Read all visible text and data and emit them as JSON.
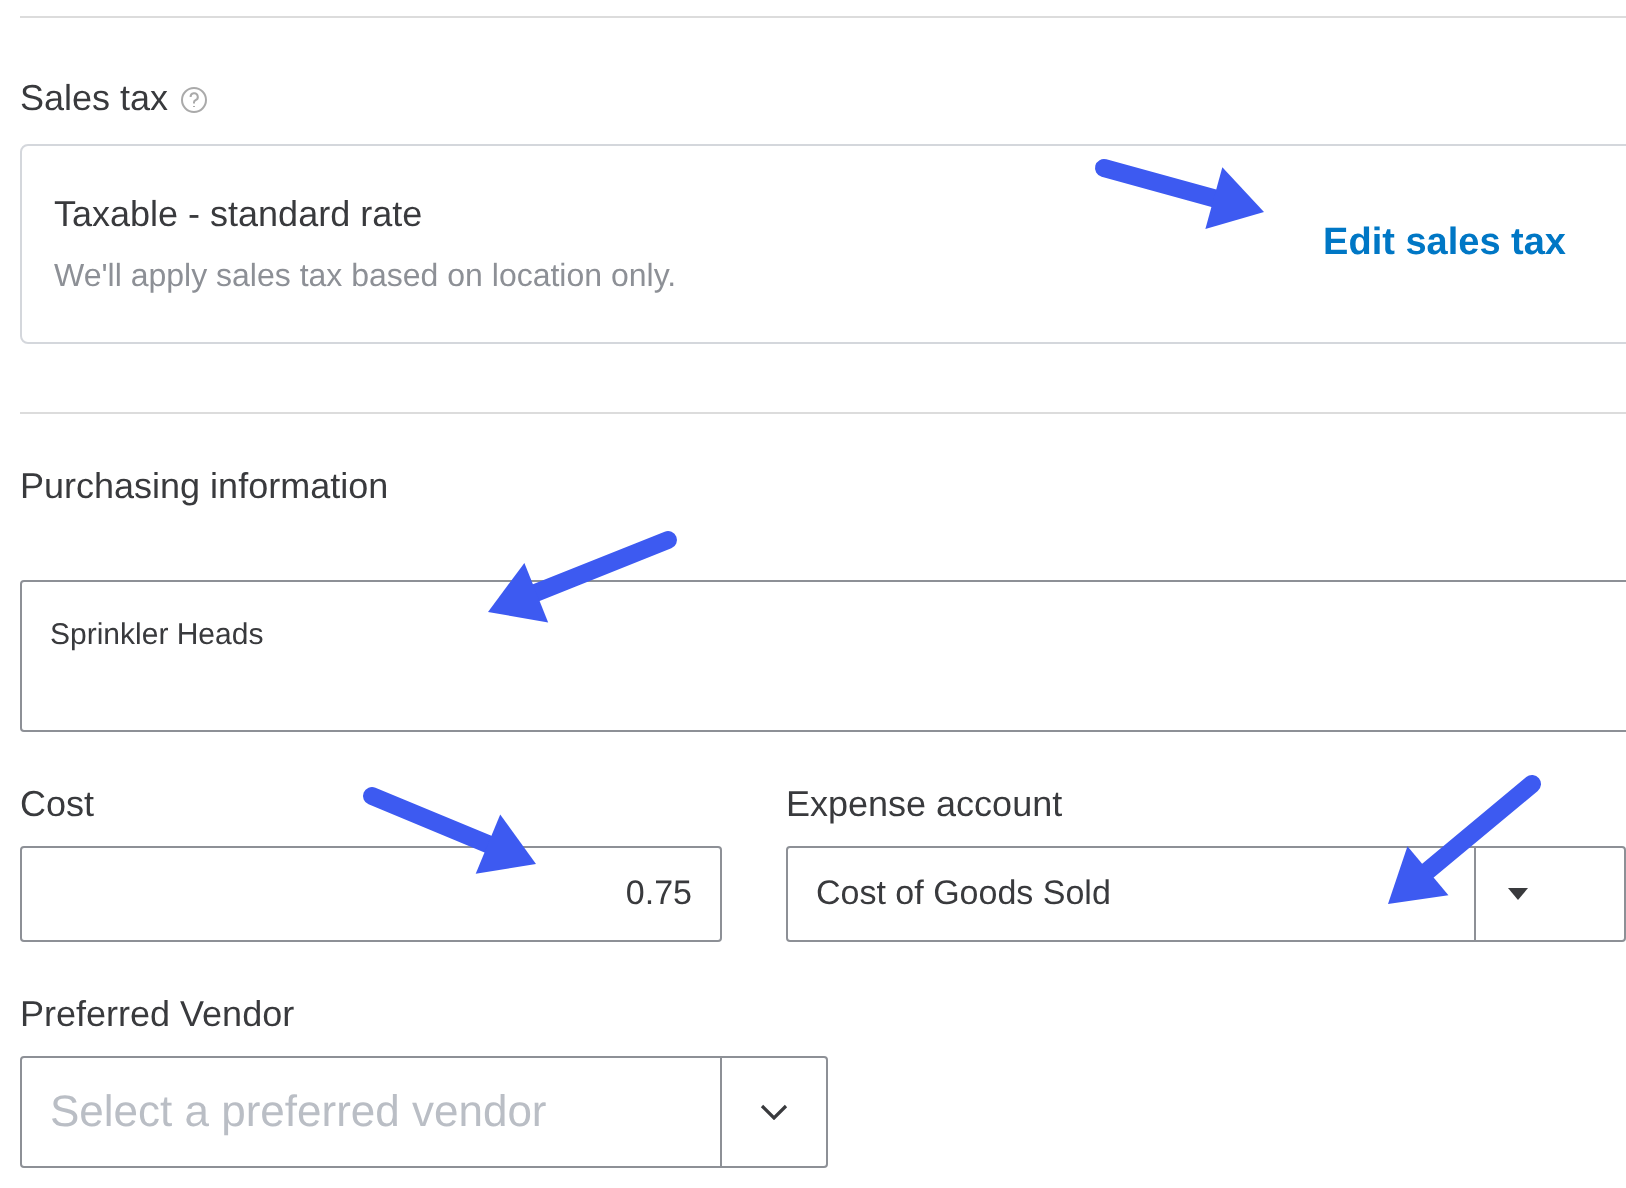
{
  "sales_tax": {
    "label": "Sales tax",
    "status": "Taxable - standard rate",
    "note": "We'll apply sales tax based on location only.",
    "edit_link": "Edit sales tax"
  },
  "purchasing": {
    "label": "Purchasing information",
    "description": "Sprinkler Heads"
  },
  "cost": {
    "label": "Cost",
    "value": "0.75"
  },
  "expense_account": {
    "label": "Expense account",
    "value": "Cost of Goods Sold"
  },
  "preferred_vendor": {
    "label": "Preferred Vendor",
    "placeholder": "Select a preferred vendor"
  }
}
